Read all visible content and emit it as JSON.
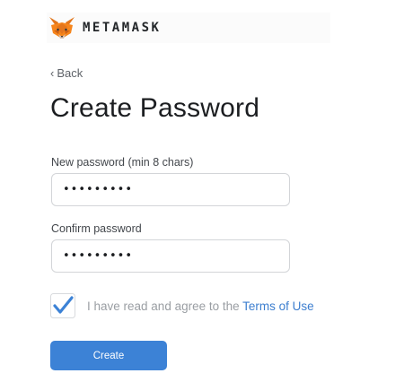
{
  "header": {
    "brand": "METAMASK",
    "logo_icon": "fox-icon"
  },
  "nav": {
    "back_label": "Back",
    "back_icon": "chevron-left-icon"
  },
  "page": {
    "title": "Create Password"
  },
  "form": {
    "new_password": {
      "label": "New password (min 8 chars)",
      "value": "•••••••••"
    },
    "confirm_password": {
      "label": "Confirm password",
      "value": "•••••••••"
    },
    "terms": {
      "checked": true,
      "text": "I have read and agree to the ",
      "link": "Terms of Use"
    },
    "submit_label": "Create"
  },
  "colors": {
    "accent": "#3c82d6",
    "link": "#3c7ecf",
    "check": "#3c82d6",
    "title": "#1c1e21"
  }
}
